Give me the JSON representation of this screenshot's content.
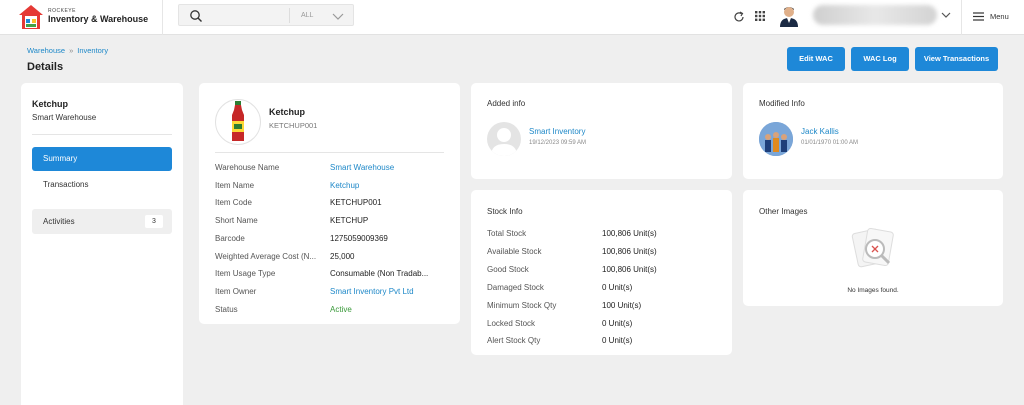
{
  "header": {
    "brand_small": "ROCKEYE",
    "brand_title": "Inventory & Warehouse",
    "search": {
      "value": "",
      "scope": "ALL"
    },
    "menu_label": "Menu",
    "icons": [
      "search-icon",
      "chevron-down-icon",
      "refresh-icon",
      "apps-grid-icon",
      "user-avatar",
      "menu-icon"
    ]
  },
  "breadcrumb": [
    "Warehouse",
    "Inventory"
  ],
  "page_title": "Details",
  "actions": {
    "edit_wac": "Edit WAC",
    "wac_log": "WAC Log",
    "view_transactions": "View Transactions"
  },
  "sidebar": {
    "title": "Ketchup",
    "subtitle": "Smart Warehouse",
    "items": [
      {
        "label": "Summary",
        "active": true
      },
      {
        "label": "Transactions",
        "active": false
      }
    ],
    "activities": {
      "label": "Activities",
      "count": "3"
    }
  },
  "item": {
    "name": "Ketchup",
    "code": "KETCHUP001",
    "fields": [
      {
        "label": "Warehouse Name",
        "value": "Smart Warehouse",
        "style": "link"
      },
      {
        "label": "Item Name",
        "value": "Ketchup",
        "style": "link"
      },
      {
        "label": "Item Code",
        "value": "KETCHUP001",
        "style": "plain"
      },
      {
        "label": "Short Name",
        "value": "KETCHUP",
        "style": "plain"
      },
      {
        "label": "Barcode",
        "value": "1275059009369",
        "style": "plain"
      },
      {
        "label": "Weighted Average Cost (N...",
        "value": "25,000",
        "style": "plain"
      },
      {
        "label": "Item Usage Type",
        "value": "Consumable (Non Tradab...",
        "style": "plain"
      },
      {
        "label": "Item Owner",
        "value": "Smart Inventory Pvt Ltd",
        "style": "link"
      },
      {
        "label": "Status",
        "value": "Active",
        "style": "green"
      }
    ]
  },
  "added_info": {
    "title": "Added info",
    "name": "Smart Inventory",
    "date": "19/12/2023 09:59 AM"
  },
  "modified_info": {
    "title": "Modified Info",
    "name": "Jack Kallis",
    "date": "01/01/1970 01:00 AM"
  },
  "stock_info": {
    "title": "Stock Info",
    "rows": [
      {
        "label": "Total Stock",
        "value": "100,806 Unit(s)"
      },
      {
        "label": "Available Stock",
        "value": "100,806 Unit(s)"
      },
      {
        "label": "Good Stock",
        "value": "100,806 Unit(s)"
      },
      {
        "label": "Damaged Stock",
        "value": "0 Unit(s)"
      },
      {
        "label": "Minimum Stock Qty",
        "value": "100 Unit(s)"
      },
      {
        "label": "Locked Stock",
        "value": "0 Unit(s)"
      },
      {
        "label": "Alert Stock Qty",
        "value": "0 Unit(s)"
      }
    ]
  },
  "other_images": {
    "title": "Other Images",
    "empty_text": "No Images found."
  },
  "colors": {
    "primary": "#1e88d8",
    "link": "#1e88c8",
    "active_status": "#3a9a3a",
    "background": "#efefef"
  }
}
